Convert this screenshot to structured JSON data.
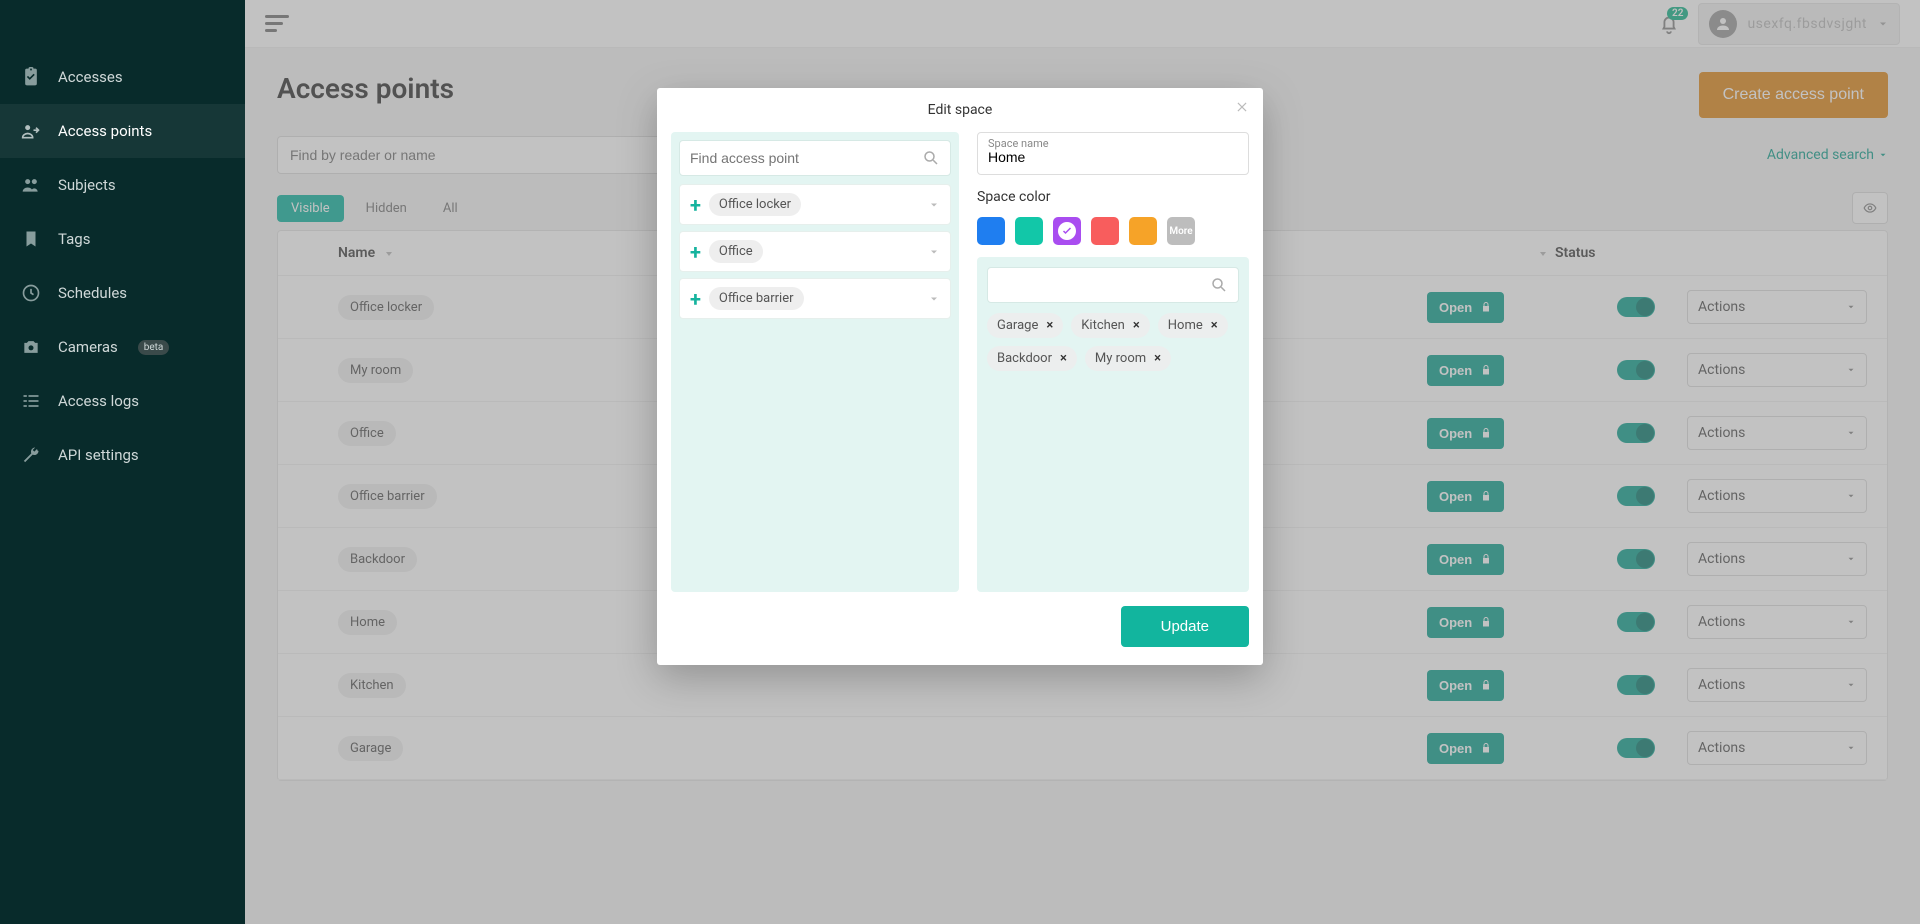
{
  "sidebar": {
    "items": [
      {
        "label": "Accesses",
        "icon": "clipboard-check-icon"
      },
      {
        "label": "Access points",
        "icon": "access-point-icon",
        "active": true
      },
      {
        "label": "Subjects",
        "icon": "people-icon"
      },
      {
        "label": "Tags",
        "icon": "tag-icon"
      },
      {
        "label": "Schedules",
        "icon": "clock-icon"
      },
      {
        "label": "Cameras",
        "icon": "camera-icon",
        "badge": "beta"
      },
      {
        "label": "Access logs",
        "icon": "list-icon"
      },
      {
        "label": "API settings",
        "icon": "wrench-icon"
      }
    ]
  },
  "topbar": {
    "notifications": "22",
    "username": "usexfq.fbsdvsjght"
  },
  "page": {
    "title": "Access points",
    "create_button": "Create access point",
    "search_placeholder": "Find by reader or name",
    "advanced_search": "Advanced search",
    "tabs": {
      "visible": "Visible",
      "hidden": "Hidden",
      "all": "All"
    },
    "columns": {
      "name": "Name",
      "status": "Status",
      "actions": "Actions",
      "open": "Open"
    },
    "rows": [
      {
        "name": "Office locker"
      },
      {
        "name": "My room"
      },
      {
        "name": "Office"
      },
      {
        "name": "Office barrier"
      },
      {
        "name": "Backdoor"
      },
      {
        "name": "Home"
      },
      {
        "name": "Kitchen"
      },
      {
        "name": "Garage"
      }
    ]
  },
  "modal": {
    "title": "Edit space",
    "find_ap_placeholder": "Find access point",
    "available_aps": [
      {
        "name": "Office locker"
      },
      {
        "name": "Office"
      },
      {
        "name": "Office barrier"
      }
    ],
    "space_name_label": "Space name",
    "space_name_value": "Home",
    "space_color_label": "Space color",
    "colors": {
      "blue": "#1f7ef0",
      "teal": "#12c7a8",
      "purple": "#a94df0",
      "red": "#f85d5d",
      "orange": "#f6a328",
      "more": "More"
    },
    "selected_color_index": 2,
    "selected_aps": [
      "Garage",
      "Kitchen",
      "Home",
      "Backdoor",
      "My room"
    ],
    "update_button": "Update"
  }
}
